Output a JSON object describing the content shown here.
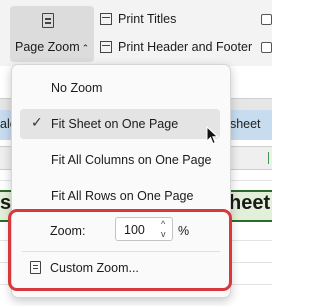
{
  "ribbon": {
    "page_zoom_label": "Page Zoom",
    "print_titles_label": "Print Titles",
    "print_header_footer_label": "Print Header and Footer"
  },
  "sheet": {
    "left_fragment": "ale",
    "right_fragment": "dsheet",
    "col_marker": "I",
    "big_left": "sh",
    "big_right": "heet"
  },
  "menu": {
    "items": [
      {
        "label": "No Zoom",
        "checked": false
      },
      {
        "label": "Fit Sheet on One Page",
        "checked": true
      },
      {
        "label": "Fit All Columns on One Page",
        "checked": false
      },
      {
        "label": "Fit All Rows on One Page",
        "checked": false
      }
    ],
    "check_glyph": "✓",
    "zoom_label": "Zoom:",
    "zoom_value": "100",
    "zoom_unit": "%",
    "custom_zoom_label": "Custom Zoom...",
    "spin_up_glyph": "^",
    "spin_down_glyph": "v"
  },
  "colors": {
    "highlight": "#d9383a",
    "selected_item_bg": "#e4e4e4",
    "header_band": "#c8dcf0",
    "title_row": "#e2efd9"
  }
}
